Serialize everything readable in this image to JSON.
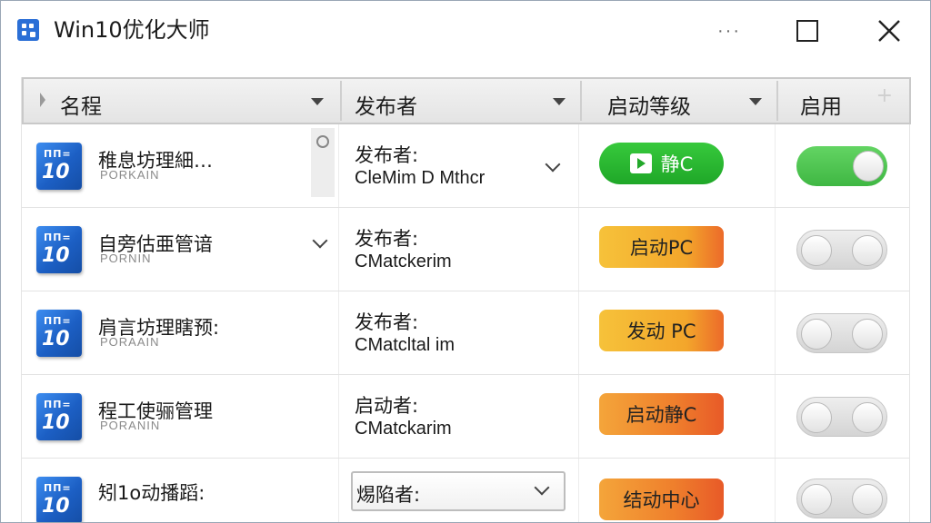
{
  "window": {
    "title": "Win10优化大师",
    "more_label": "···"
  },
  "table": {
    "headers": {
      "name": "名程",
      "publisher": "发布者",
      "level": "启动等级",
      "enabled": "启用",
      "add": "+"
    },
    "rows": [
      {
        "name": "稚息坊理細…",
        "sub": "PORKAIN",
        "publisher_label": "发布者:",
        "publisher": "CleMim D Mthcr",
        "badge": "静C",
        "badge_color": "#23ad2b",
        "enabled": true
      },
      {
        "name": "自旁估亜管谙",
        "sub": "PORNIN",
        "publisher_label": "发布者:",
        "publisher": "CMatckerim",
        "badge": "启动PC",
        "badge_color": "#f4b431",
        "enabled": false
      },
      {
        "name": "肩言坊理瞎预:",
        "sub": "PORAAIN",
        "publisher_label": "发布者:",
        "publisher": "CMatcltal im",
        "badge": "发动 PC",
        "badge_color": "#f4b431",
        "enabled": false
      },
      {
        "name": "程工使骊管理",
        "sub": "PORANIN",
        "publisher_label": "启动者:",
        "publisher": "CMatckarim",
        "badge": "启动静C",
        "badge_color": "#ef7f2c",
        "enabled": false
      },
      {
        "name": "矧1o动播蹈:",
        "sub": "",
        "publisher_label": "焬陷者:",
        "publisher": "",
        "badge": "结动中心",
        "badge_color": "#ef7f2c",
        "enabled": false
      }
    ]
  },
  "icons": {
    "app_logo": "app-logo-icon",
    "app_row_icon": "win10-tile-icon",
    "close": "close-icon",
    "maximize": "maximize-icon",
    "sort": "sort-caret-icon",
    "dropdown": "chevron-down-icon",
    "play": "play-icon"
  }
}
